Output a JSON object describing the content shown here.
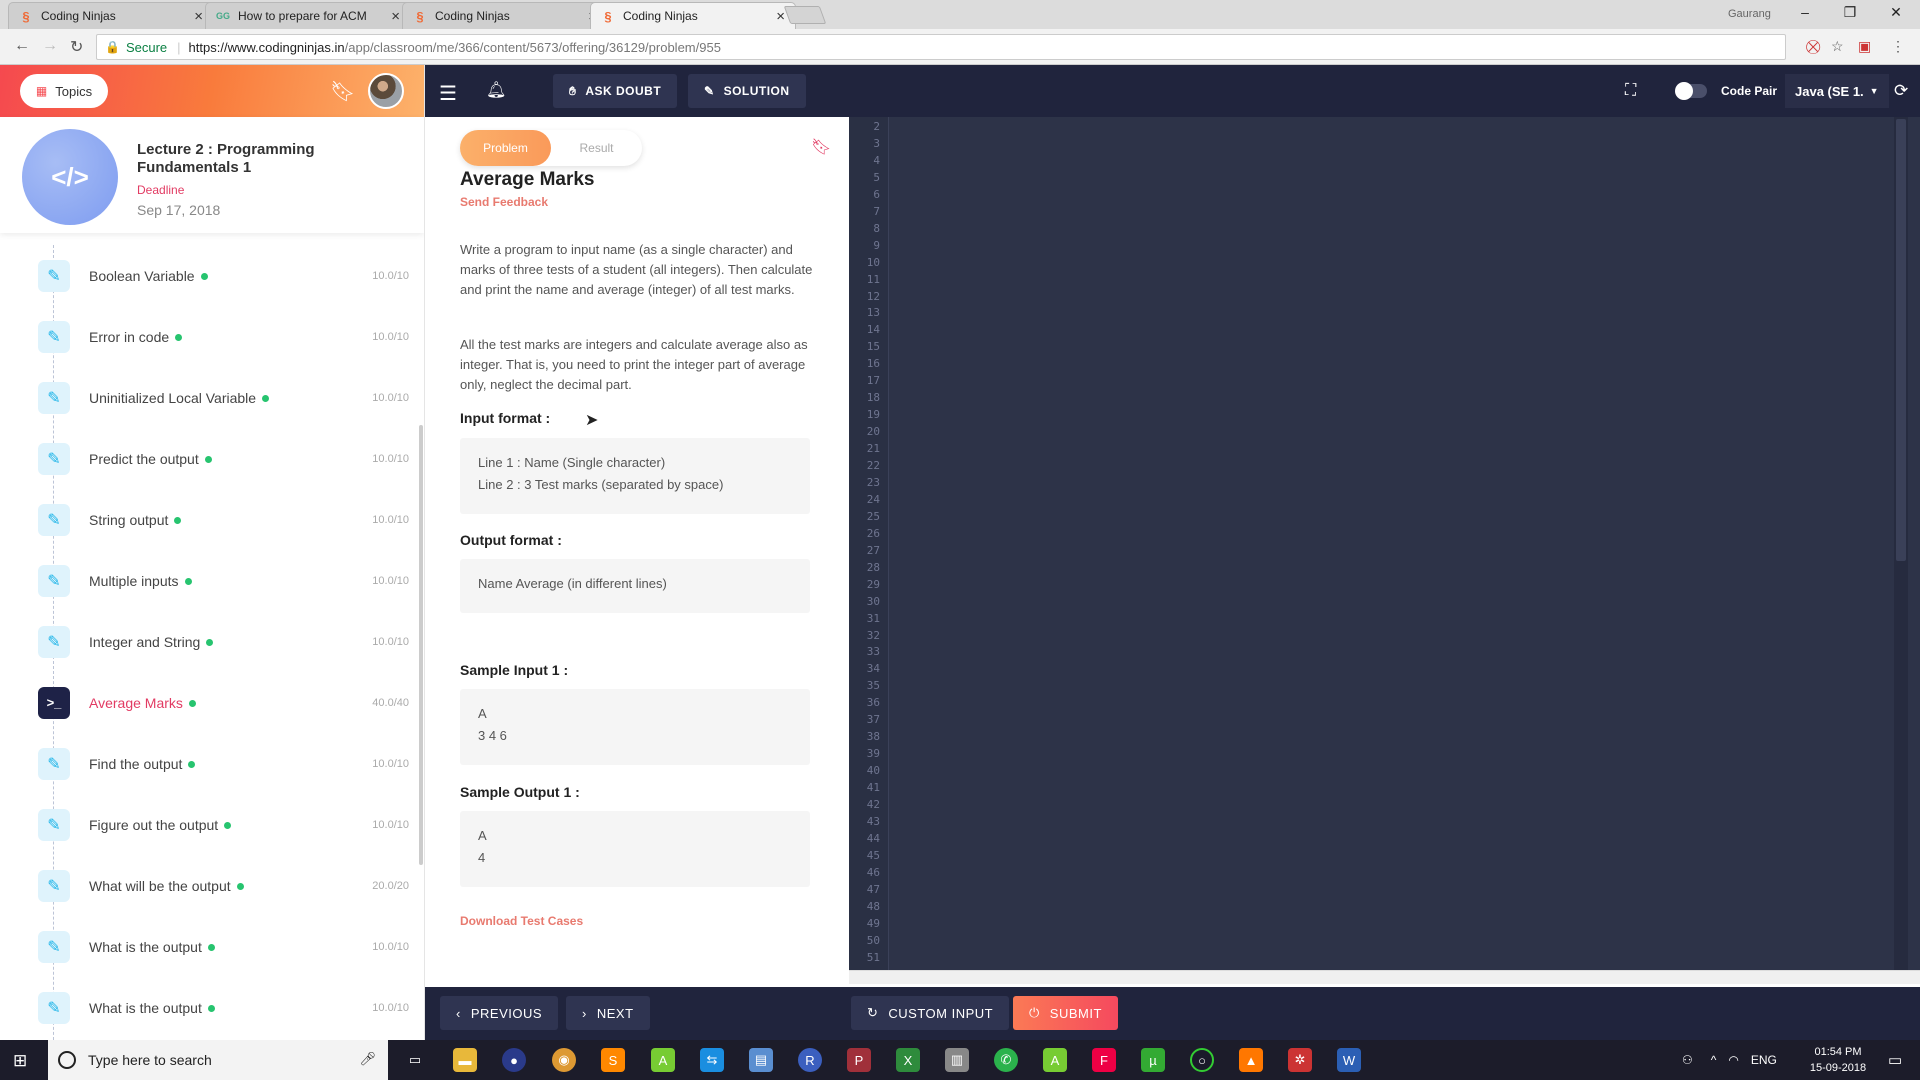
{
  "browser": {
    "tabs": [
      {
        "title": "Coding Ninjas",
        "active": false
      },
      {
        "title": "How to prepare for ACM",
        "active": false
      },
      {
        "title": "Coding Ninjas",
        "active": false
      },
      {
        "title": "Coding Ninjas",
        "active": true
      }
    ],
    "user_label": "Gaurang",
    "secure_label": "Secure",
    "url_host": "https://www.codingninjas.in",
    "url_path": "/app/classroom/me/366/content/5673/offering/36129/problem/955"
  },
  "sidebar": {
    "topics_label": "Topics",
    "lecture_title": "Lecture 2 : Programming Fundamentals 1",
    "deadline_label": "Deadline",
    "deadline_date": "Sep 17, 2018",
    "items": [
      {
        "name": "Boolean Variable",
        "score": "10.0/10"
      },
      {
        "name": "Error in code",
        "score": "10.0/10"
      },
      {
        "name": "Uninitialized Local Variable",
        "score": "10.0/10"
      },
      {
        "name": "Predict the output",
        "score": "10.0/10"
      },
      {
        "name": "String output",
        "score": "10.0/10"
      },
      {
        "name": "Multiple inputs",
        "score": "10.0/10"
      },
      {
        "name": "Integer and String",
        "score": "10.0/10"
      },
      {
        "name": "Average Marks",
        "score": "40.0/40"
      },
      {
        "name": "Find the output",
        "score": "10.0/10"
      },
      {
        "name": "Figure out the output",
        "score": "10.0/10"
      },
      {
        "name": "What will be the output",
        "score": "20.0/20"
      },
      {
        "name": "What is the output",
        "score": "10.0/10"
      },
      {
        "name": "What is the output",
        "score": "10.0/10"
      }
    ]
  },
  "toolbar": {
    "ask_doubt": "ASK DOUBT",
    "solution": "SOLUTION",
    "code_pair": "Code Pair",
    "language": "Java (SE 1."
  },
  "problem": {
    "tab_problem": "Problem",
    "tab_result": "Result",
    "title": "Average Marks",
    "send_feedback": "Send Feedback",
    "para1": "Write a program to input name (as a single character) and marks of three tests of a student (all integers). Then calculate and print the name and average (integer) of all test marks.",
    "para2": "All the test marks are integers and calculate average also as integer. That is, you need to print the integer part of average only, neglect the decimal part.",
    "input_format_label": "Input format :",
    "input_format_line1": "Line 1 : Name (Single character)",
    "input_format_line2": "Line 2 : 3 Test marks (separated by space)",
    "output_format_label": "Output format :",
    "output_format_text": "Name Average (in different lines)",
    "sample_input_label": "Sample Input 1 :",
    "sample_input_line1": "A",
    "sample_input_line2": "3 4 6",
    "sample_output_label": "Sample Output 1 :",
    "sample_output_line1": "A",
    "sample_output_line2": "4",
    "download_label": "Download Test Cases"
  },
  "editor": {
    "first_line": 2,
    "last_line": 51
  },
  "bottom": {
    "previous": "PREVIOUS",
    "next": "NEXT",
    "custom_input": "CUSTOM INPUT",
    "submit": "SUBMIT"
  },
  "taskbar": {
    "search_placeholder": "Type here to search",
    "lang": "ENG",
    "time": "01:54 PM",
    "date": "15-09-2018"
  }
}
